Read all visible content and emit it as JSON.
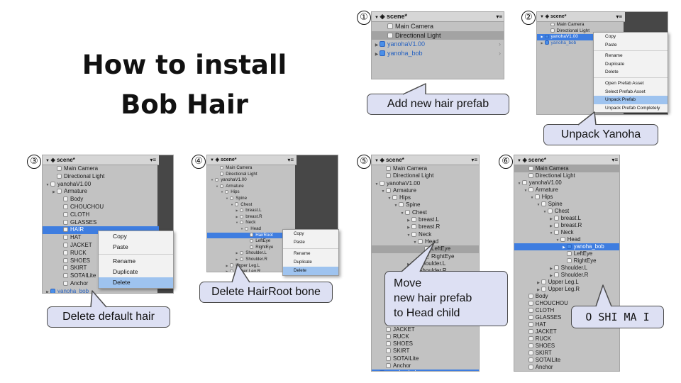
{
  "title": {
    "line1": "How to install",
    "line2": "Bob Hair"
  },
  "panels": [
    {
      "step": "①",
      "header": "scene*",
      "rows": [
        {
          "label": "Main Camera",
          "indent": 1
        },
        {
          "label": "Directional Light",
          "indent": 1,
          "state": "hl"
        },
        {
          "label": "yanohaV1.00",
          "indent": 0,
          "icon": "prefab",
          "blue": true,
          "arrow": "right",
          "chev": true
        },
        {
          "label": "yanoha_bob",
          "indent": 0,
          "icon": "prefab",
          "blue": true,
          "arrow": "right",
          "chev": true
        }
      ],
      "callout": "Add new hair prefab"
    },
    {
      "step": "②",
      "header": "scene*",
      "rows": [
        {
          "label": "Main Camera",
          "indent": 1
        },
        {
          "label": "Directional Light",
          "indent": 1
        },
        {
          "label": "yanohaV1.00",
          "indent": 0,
          "icon": "prefab",
          "arrow": "right",
          "state": "sel"
        },
        {
          "label": "yanoha_bob",
          "indent": 0,
          "icon": "prefab",
          "blue": true,
          "arrow": "right"
        }
      ],
      "menu": [
        "Copy",
        "Paste",
        "-",
        "Rename",
        "Duplicate",
        "Delete",
        "-",
        "Open Prefab Asset",
        "Select Prefab Asset",
        "Unpack Prefab",
        "Unpack Prefab Completely"
      ],
      "menu_selected": "Unpack Prefab",
      "callout": "Unpack Yanoha"
    },
    {
      "step": "③",
      "header": "scene*",
      "rows": [
        {
          "label": "Main Camera",
          "indent": 1
        },
        {
          "label": "Directional Light",
          "indent": 1
        },
        {
          "label": "yanohaV1.00",
          "indent": 0,
          "arrow": "down"
        },
        {
          "label": "Armature",
          "indent": 1,
          "arrow": "right"
        },
        {
          "label": "Body",
          "indent": 2
        },
        {
          "label": "CHOUCHOU",
          "indent": 2
        },
        {
          "label": "CLOTH",
          "indent": 2
        },
        {
          "label": "GLASSES",
          "indent": 2
        },
        {
          "label": "HAIR",
          "indent": 2,
          "state": "sel"
        },
        {
          "label": "HAT",
          "indent": 2
        },
        {
          "label": "JACKET",
          "indent": 2
        },
        {
          "label": "RUCK",
          "indent": 2
        },
        {
          "label": "SHOES",
          "indent": 2
        },
        {
          "label": "SKIRT",
          "indent": 2
        },
        {
          "label": "SOTAILite",
          "indent": 2
        },
        {
          "label": "Anchor",
          "indent": 2
        },
        {
          "label": "yanoha_bob",
          "indent": 0,
          "icon": "prefab",
          "blue": true,
          "arrow": "right"
        }
      ],
      "menu": [
        "Copy",
        "Paste",
        "-",
        "Rename",
        "Duplicate",
        "Delete"
      ],
      "menu_selected": "Delete",
      "callout": "Delete default hair"
    },
    {
      "step": "④",
      "header": "scene*",
      "rows": [
        {
          "label": "Main Camera",
          "indent": 1
        },
        {
          "label": "Directional Light",
          "indent": 1
        },
        {
          "label": "yanohaV1.00",
          "indent": 0,
          "arrow": "down"
        },
        {
          "label": "Armature",
          "indent": 1,
          "arrow": "down"
        },
        {
          "label": "Hips",
          "indent": 2,
          "arrow": "down"
        },
        {
          "label": "Spine",
          "indent": 3,
          "arrow": "down"
        },
        {
          "label": "Chest",
          "indent": 4,
          "arrow": "down"
        },
        {
          "label": "breast.L",
          "indent": 5,
          "arrow": "right"
        },
        {
          "label": "breast.R",
          "indent": 5,
          "arrow": "right"
        },
        {
          "label": "Neck",
          "indent": 5,
          "arrow": "down"
        },
        {
          "label": "Head",
          "indent": 6,
          "arrow": "down"
        },
        {
          "label": "HairRoot",
          "indent": 7,
          "state": "sel"
        },
        {
          "label": "LeftEye",
          "indent": 7
        },
        {
          "label": "RightEye",
          "indent": 7
        },
        {
          "label": "Shoulder.L",
          "indent": 5,
          "arrow": "right"
        },
        {
          "label": "Shoulder.R",
          "indent": 5,
          "arrow": "right"
        },
        {
          "label": "Upper Leg.L",
          "indent": 3,
          "arrow": "right"
        },
        {
          "label": "Upper Leg.R",
          "indent": 3,
          "arrow": "right"
        },
        {
          "label": "Body",
          "indent": 1
        }
      ],
      "menu": [
        "Copy",
        "Paste",
        "-",
        "Rename",
        "Duplicate",
        "Delete"
      ],
      "menu_selected": "Delete",
      "callout": "Delete HairRoot bone"
    },
    {
      "step": "⑤",
      "header": "scene*",
      "rows": [
        {
          "label": "Main Camera",
          "indent": 1
        },
        {
          "label": "Directional Light",
          "indent": 1
        },
        {
          "label": "yanohaV1.00",
          "indent": 0,
          "arrow": "down"
        },
        {
          "label": "Armature",
          "indent": 1,
          "arrow": "down"
        },
        {
          "label": "Hips",
          "indent": 2,
          "arrow": "down"
        },
        {
          "label": "Spine",
          "indent": 3,
          "arrow": "down"
        },
        {
          "label": "Chest",
          "indent": 4,
          "arrow": "down"
        },
        {
          "label": "breast.L",
          "indent": 5,
          "arrow": "right"
        },
        {
          "label": "breast.R",
          "indent": 5,
          "arrow": "right"
        },
        {
          "label": "Neck",
          "indent": 5,
          "arrow": "down"
        },
        {
          "label": "Head",
          "indent": 6,
          "arrow": "down"
        },
        {
          "label": "LeftEye",
          "indent": 7,
          "state": "hl"
        },
        {
          "label": "RightEye",
          "indent": 7
        },
        {
          "label": "Shoulder.L",
          "indent": 5,
          "arrow": "right"
        },
        {
          "label": "Shoulder.R",
          "indent": 5,
          "arrow": "right"
        },
        {
          "label": "Upper Leg.L",
          "indent": 3,
          "arrow": "right"
        },
        {
          "label": "Upper Leg.R",
          "indent": 3,
          "arrow": "right"
        },
        {
          "label": "Body",
          "indent": 1
        },
        {
          "label": "CHOUCHOU",
          "indent": 1
        },
        {
          "label": "CLOTH",
          "indent": 1
        },
        {
          "label": "GLASSES",
          "indent": 1
        },
        {
          "label": "HAT",
          "indent": 1
        },
        {
          "label": "JACKET",
          "indent": 1
        },
        {
          "label": "RUCK",
          "indent": 1
        },
        {
          "label": "SHOES",
          "indent": 1
        },
        {
          "label": "SKIRT",
          "indent": 1
        },
        {
          "label": "SOTAILite",
          "indent": 1
        },
        {
          "label": "Anchor",
          "indent": 1
        },
        {
          "label": "yanoha_bob",
          "indent": 0,
          "icon": "prefab",
          "arrow": "right",
          "state": "sel"
        }
      ],
      "callout_lines": [
        "Move",
        "new hair prefab",
        "to Head child"
      ]
    },
    {
      "step": "⑥",
      "header": "scene*",
      "rows": [
        {
          "label": "Main Camera",
          "indent": 1,
          "state": "hl"
        },
        {
          "label": "Directional Light",
          "indent": 1
        },
        {
          "label": "yanohaV1.00",
          "indent": 0,
          "arrow": "down"
        },
        {
          "label": "Armature",
          "indent": 1,
          "arrow": "down"
        },
        {
          "label": "Hips",
          "indent": 2,
          "arrow": "down"
        },
        {
          "label": "Spine",
          "indent": 3,
          "arrow": "down"
        },
        {
          "label": "Chest",
          "indent": 4,
          "arrow": "down"
        },
        {
          "label": "breast.L",
          "indent": 5,
          "arrow": "right"
        },
        {
          "label": "breast.R",
          "indent": 5,
          "arrow": "right"
        },
        {
          "label": "Neck",
          "indent": 5,
          "arrow": "down"
        },
        {
          "label": "Head",
          "indent": 6,
          "arrow": "down"
        },
        {
          "label": "yanoha_bob",
          "indent": 7,
          "icon": "prefab",
          "arrow": "right",
          "state": "sel"
        },
        {
          "label": "LeftEye",
          "indent": 7
        },
        {
          "label": "RightEye",
          "indent": 7
        },
        {
          "label": "Shoulder.L",
          "indent": 5,
          "arrow": "right"
        },
        {
          "label": "Shoulder.R",
          "indent": 5,
          "arrow": "right"
        },
        {
          "label": "Upper Leg.L",
          "indent": 3,
          "arrow": "right"
        },
        {
          "label": "Upper Leg.R",
          "indent": 3,
          "arrow": "right"
        },
        {
          "label": "Body",
          "indent": 1
        },
        {
          "label": "CHOUCHOU",
          "indent": 1
        },
        {
          "label": "CLOTH",
          "indent": 1
        },
        {
          "label": "GLASSES",
          "indent": 1
        },
        {
          "label": "HAT",
          "indent": 1
        },
        {
          "label": "JACKET",
          "indent": 1
        },
        {
          "label": "RUCK",
          "indent": 1
        },
        {
          "label": "SHOES",
          "indent": 1
        },
        {
          "label": "SKIRT",
          "indent": 1
        },
        {
          "label": "SOTAILite",
          "indent": 1
        },
        {
          "label": "Anchor",
          "indent": 1
        }
      ],
      "callout": "O SHI MA I"
    }
  ],
  "icons": {
    "arrow_down": "▼",
    "arrow_right": "▶",
    "scene_icon": "unity-scene-icon",
    "menu_icon": "panel-menu-icon"
  },
  "colors": {
    "selection": "#3e7de0",
    "menu_selection": "#9ec3ef",
    "callout_fill": "#dde0f3",
    "panel_bg": "#c2c2c2",
    "prefab_text": "#2561c0"
  }
}
